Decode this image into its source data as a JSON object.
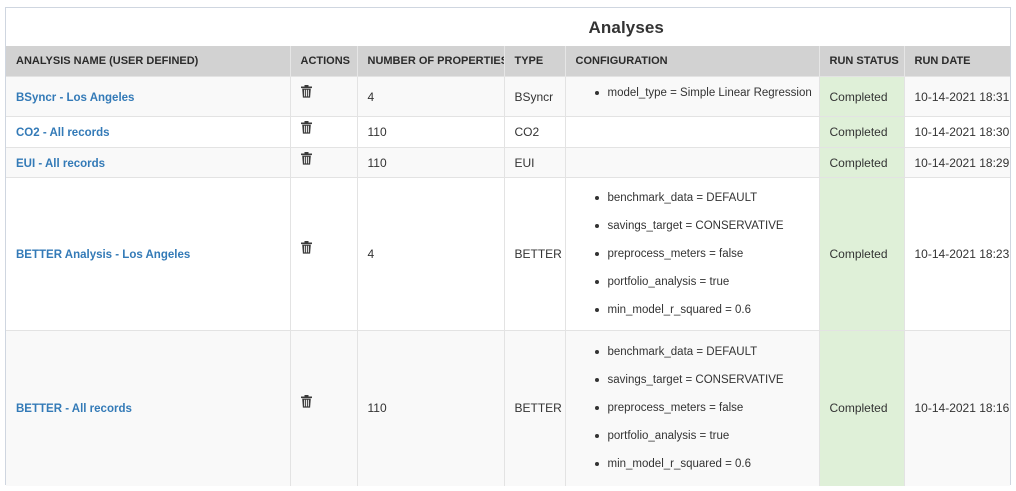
{
  "panel": {
    "title": "Analyses"
  },
  "table": {
    "columns": [
      "ANALYSIS NAME (USER DEFINED)",
      "ACTIONS",
      "NUMBER OF PROPERTIES",
      "TYPE",
      "CONFIGURATION",
      "RUN STATUS",
      "RUN DATE"
    ],
    "rows": [
      {
        "name": "BSyncr - Los Angeles",
        "action_icon": "trash-icon",
        "properties": "4",
        "type": "BSyncr",
        "config": [
          "model_type = Simple Linear Regression"
        ],
        "status": "Completed",
        "date": "10-14-2021 18:31"
      },
      {
        "name": "CO2 - All records",
        "action_icon": "trash-icon",
        "properties": "110",
        "type": "CO2",
        "config": [],
        "status": "Completed",
        "date": "10-14-2021 18:30"
      },
      {
        "name": "EUI - All records",
        "action_icon": "trash-icon",
        "properties": "110",
        "type": "EUI",
        "config": [],
        "status": "Completed",
        "date": "10-14-2021 18:29"
      },
      {
        "name": "BETTER Analysis - Los Angeles",
        "action_icon": "trash-icon",
        "properties": "4",
        "type": "BETTER",
        "config": [
          "benchmark_data = DEFAULT",
          "savings_target = CONSERVATIVE",
          "preprocess_meters = false",
          "portfolio_analysis = true",
          "min_model_r_squared = 0.6"
        ],
        "status": "Completed",
        "date": "10-14-2021 18:23"
      },
      {
        "name": "BETTER - All records",
        "action_icon": "trash-icon",
        "properties": "110",
        "type": "BETTER",
        "config": [
          "benchmark_data = DEFAULT",
          "savings_target = CONSERVATIVE",
          "preprocess_meters = false",
          "portfolio_analysis = true",
          "min_model_r_squared = 0.6"
        ],
        "status": "Completed",
        "date": "10-14-2021 18:16"
      }
    ]
  },
  "colors": {
    "link": "#337ab7",
    "header_bg": "#d2d2d2",
    "status_bg": "#dff0d8",
    "stripe_bg": "#f9f9f9"
  }
}
